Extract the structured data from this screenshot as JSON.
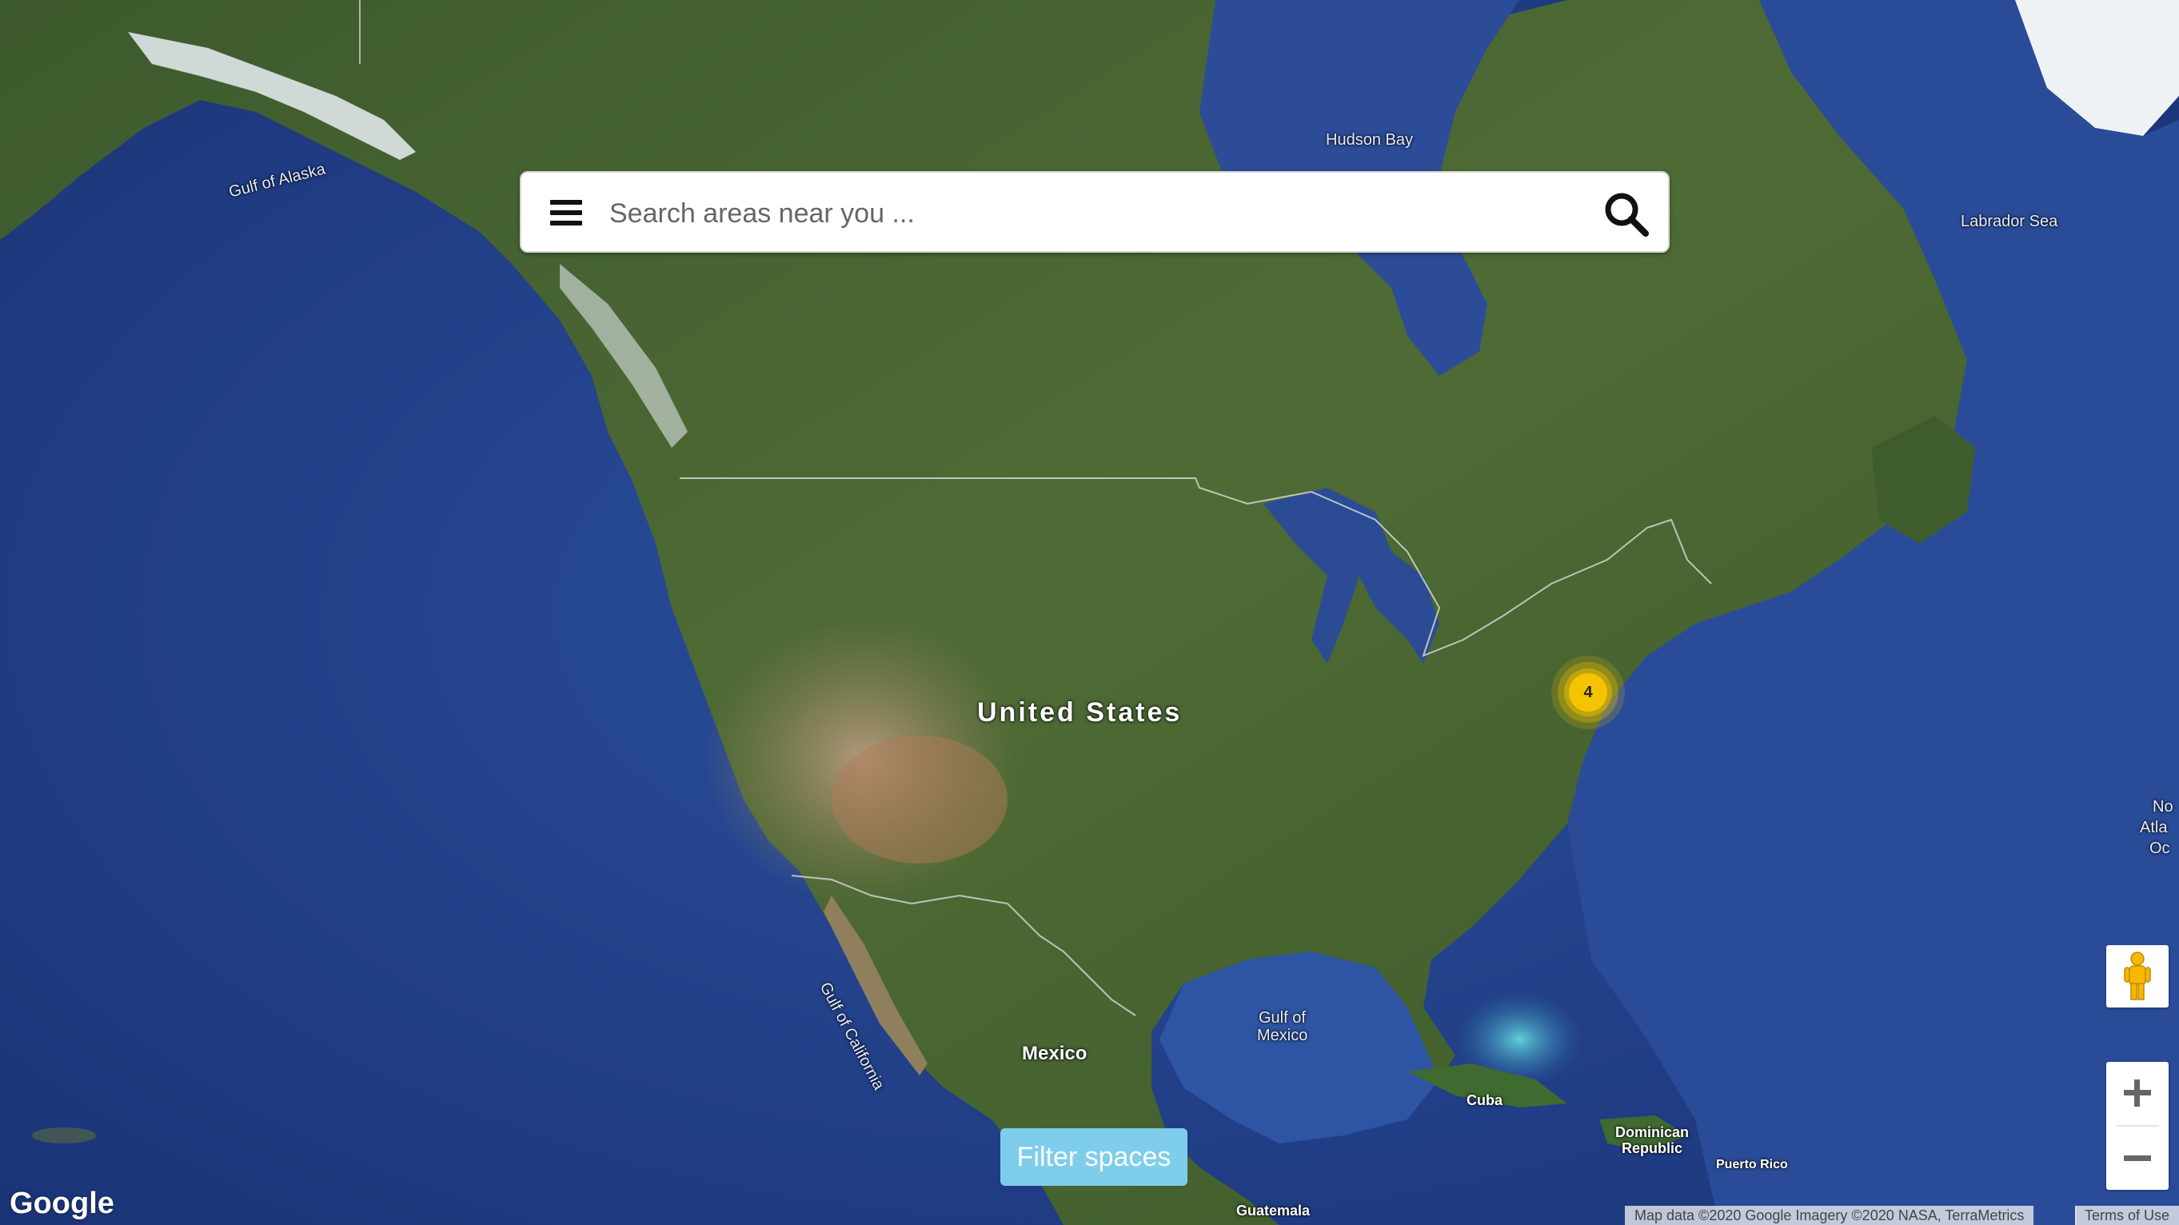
{
  "search": {
    "placeholder": "Search areas near you ...",
    "value": ""
  },
  "cluster": {
    "count": "4",
    "color": "#f5c400"
  },
  "filter_button": {
    "label": "Filter spaces",
    "color": "#7ecdeb"
  },
  "map_labels": {
    "hudson_bay": "Hudson Bay",
    "gulf_of_alaska": "Gulf of Alaska",
    "labrador_sea": "Labrador Sea",
    "united_states": "United States",
    "mexico": "Mexico",
    "gulf_of_mexico_1": "Gulf of",
    "gulf_of_mexico_2": "Mexico",
    "gulf_of_california": "Gulf of California",
    "cuba": "Cuba",
    "dominican_1": "Dominican",
    "dominican_2": "Republic",
    "puerto_rico": "Puerto Rico",
    "guatemala": "Guatemala",
    "north_atlantic_1": "No",
    "north_atlantic_2": "Atla",
    "north_atlantic_3": "Oc"
  },
  "controls": {
    "zoom_in": "+",
    "zoom_out": "−"
  },
  "footer": {
    "logo": "Google",
    "attribution": "Map data ©2020 Google Imagery ©2020 NASA, TerraMetrics",
    "terms": "Terms of Use"
  },
  "icons": {
    "menu": "hamburger-menu-icon",
    "search": "search-icon",
    "pegman": "pegman-icon"
  }
}
